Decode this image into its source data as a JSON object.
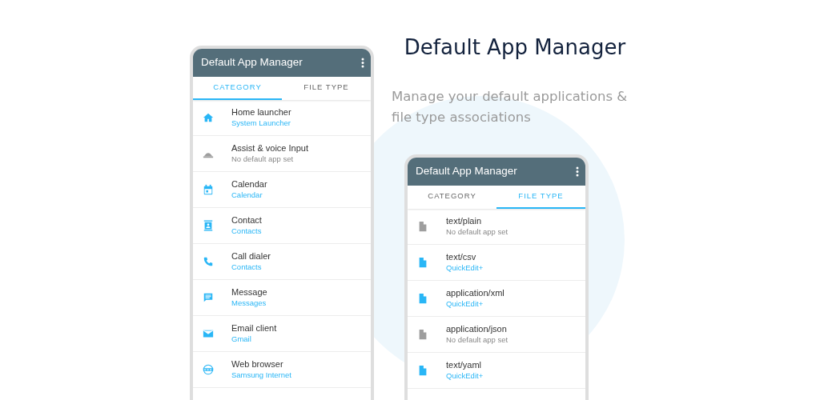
{
  "headline": "Default App Manager",
  "tagline": "Manage your default applications & file type associations",
  "phones": [
    {
      "title": "Default App Manager",
      "tabs": [
        {
          "label": "CATEGORY",
          "selected": true
        },
        {
          "label": "FILE TYPE",
          "selected": false
        }
      ],
      "items": [
        {
          "kind": "home",
          "title": "Home launcher",
          "subtitle": "System Launcher",
          "assigned": true
        },
        {
          "kind": "assist",
          "title": "Assist & voice Input",
          "subtitle": "No default app set",
          "assigned": false
        },
        {
          "kind": "calendar",
          "title": "Calendar",
          "subtitle": "Calendar",
          "assigned": true
        },
        {
          "kind": "contact",
          "title": "Contact",
          "subtitle": "Contacts",
          "assigned": true
        },
        {
          "kind": "phone",
          "title": "Call dialer",
          "subtitle": "Contacts",
          "assigned": true
        },
        {
          "kind": "message",
          "title": "Message",
          "subtitle": "Messages",
          "assigned": true
        },
        {
          "kind": "email",
          "title": "Email client",
          "subtitle": "Gmail",
          "assigned": true
        },
        {
          "kind": "web",
          "title": "Web browser",
          "subtitle": "Samsung Internet",
          "assigned": true
        }
      ]
    },
    {
      "title": "Default App Manager",
      "tabs": [
        {
          "label": "CATEGORY",
          "selected": false
        },
        {
          "label": "FILE TYPE",
          "selected": true
        }
      ],
      "items": [
        {
          "kind": "file",
          "title": "text/plain",
          "subtitle": "No default app set",
          "assigned": false
        },
        {
          "kind": "file",
          "title": "text/csv",
          "subtitle": "QuickEdit+",
          "assigned": true
        },
        {
          "kind": "file",
          "title": "application/xml",
          "subtitle": "QuickEdit+",
          "assigned": true
        },
        {
          "kind": "file",
          "title": "application/json",
          "subtitle": "No default app set",
          "assigned": false
        },
        {
          "kind": "file",
          "title": "text/yaml",
          "subtitle": "QuickEdit+",
          "assigned": true
        }
      ]
    }
  ]
}
